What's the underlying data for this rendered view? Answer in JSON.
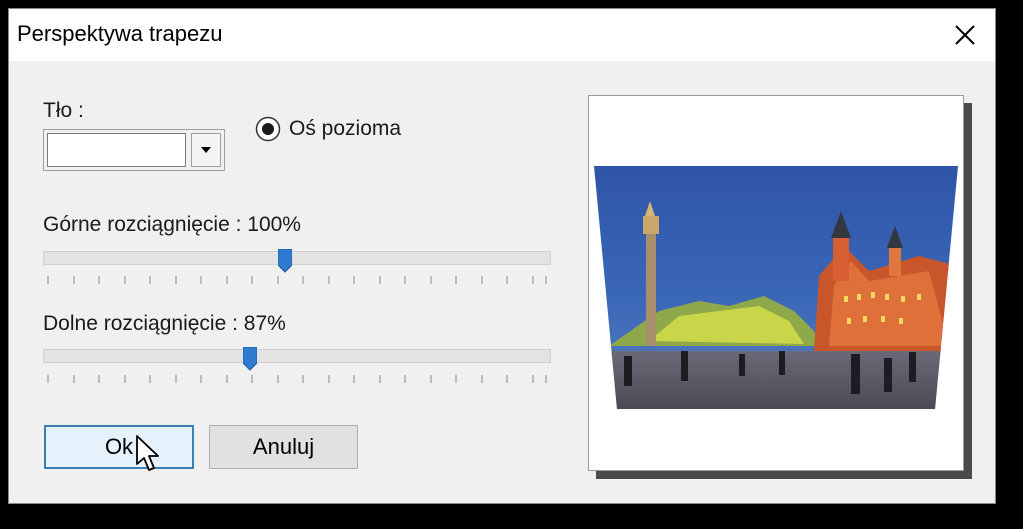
{
  "dialog": {
    "title": "Perspektywa trapezu"
  },
  "background": {
    "label": "Tło :",
    "selected_value": ""
  },
  "axis": {
    "label": "Oś pozioma",
    "checked": true
  },
  "top_stretch": {
    "label": "Górne rozciągnięcie : 100%",
    "value_percent": 100
  },
  "bottom_stretch": {
    "label": "Dolne rozciągnięcie : 87%",
    "value_percent": 87
  },
  "buttons": {
    "ok": "Ok",
    "cancel": "Anuluj"
  },
  "icons": {
    "close": "close-icon",
    "dropdown": "chevron-down-icon",
    "cursor": "mouse-pointer-icon"
  },
  "colors": {
    "thumb": "#2f7bd0",
    "ok_border": "#3c7fb1",
    "ok_fill": "#e5f1fb"
  }
}
